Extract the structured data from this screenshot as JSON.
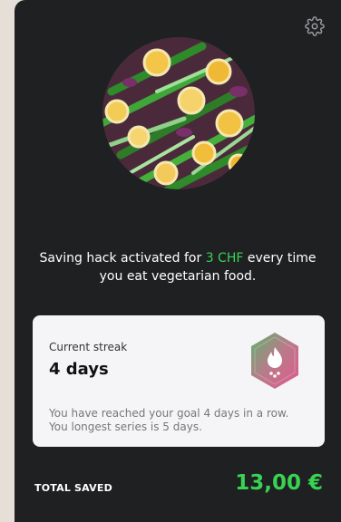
{
  "hack": {
    "text_before": "Saving hack activated for",
    "amount": "3 CHF",
    "text_after": "every time you eat vegetarian food."
  },
  "streak": {
    "label": "Current streak",
    "value": "4 days",
    "desc_line1": "You have reached your goal 4 days in a row.",
    "desc_line2": "You longest series is 5 days."
  },
  "total": {
    "label": "TOTAL SAVED",
    "value": "13,00 €"
  },
  "icons": {
    "settings": "gear-icon",
    "badge": "flame-streak-badge-icon",
    "hero": "vegetarian-food-photo"
  },
  "colors": {
    "accent_green": "#39d353",
    "card_bg": "#1f2022",
    "streak_bg": "#f5f5f7"
  }
}
